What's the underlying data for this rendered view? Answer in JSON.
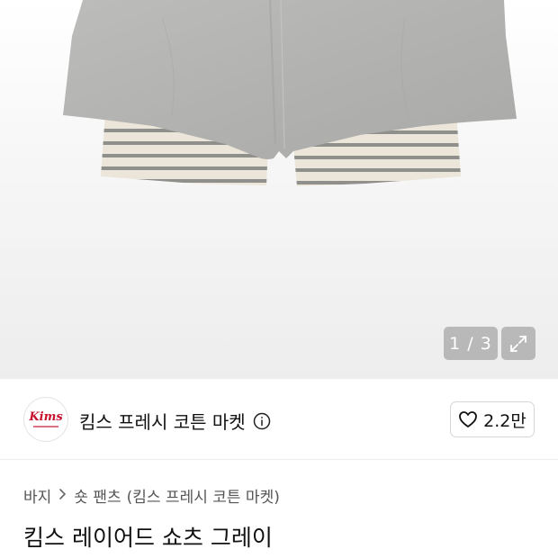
{
  "gallery": {
    "counter": "1 / 3",
    "image_alt_icon": "product-photo-shorts",
    "expand_icon": "expand-icon"
  },
  "brand": {
    "logo_text": "Kims",
    "name": "킴스 프레시 코튼 마켓",
    "likes": "2.2만"
  },
  "breadcrumb": {
    "category": "바지",
    "subcategory": "숏 팬츠",
    "brand": "(킴스 프레시 코튼 마켓)"
  },
  "product": {
    "title": "킴스 레이어드 쇼츠 그레이"
  },
  "colors": {
    "gray_fabric": "#b3b3b1",
    "stripe_cream": "#ece6da",
    "stripe_gray": "#8f8f8c",
    "logo_red": "#c8102e"
  }
}
